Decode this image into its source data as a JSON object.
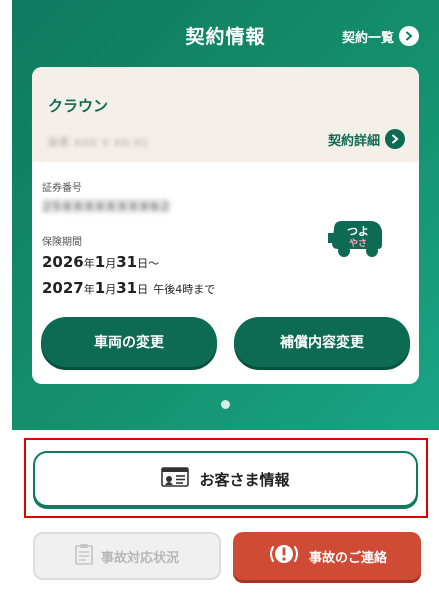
{
  "header": {
    "title": "契約情報",
    "list_link": "契約一覧"
  },
  "card": {
    "car_name": "クラウン",
    "blurred_date": "自家 XXX X XX:X1",
    "detail_link": "契約詳細",
    "policy_number_label": "証券番号",
    "policy_number_blurred": "25XXXXXXXX62",
    "insurance_period_label": "保険期間",
    "period_start": {
      "year": "2026",
      "y": "年",
      "month": "1",
      "m": "月",
      "day": "31",
      "d": "日",
      "sep": "〜"
    },
    "period_end": {
      "year": "2027",
      "y": "年",
      "month": "1",
      "m": "月",
      "day": "31",
      "d": "日",
      "note": "午後4時まで"
    },
    "badge": {
      "line1": "つよ",
      "line2": "やさ"
    },
    "vehicle_change_button": "車両の変更",
    "coverage_change_button": "補償内容変更"
  },
  "customer_info_button": "お客さま情報",
  "accident_status_button": "事故対応状況",
  "accident_contact_button": "事故のご連絡",
  "colors": {
    "brand_green": "#0e7a5f",
    "button_green": "#0d6b54",
    "contact_red": "#cf4b35",
    "highlight_red": "#e00000"
  }
}
